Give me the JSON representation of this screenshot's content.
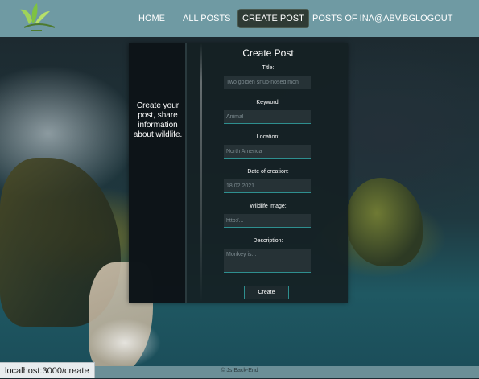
{
  "nav": {
    "home": "HOME",
    "all_posts": "ALL POSTS",
    "create_post": "CREATE POST",
    "my_posts": "POSTS OF INA@ABV.BG",
    "logout": "LOGOUT"
  },
  "form": {
    "side_text": "Create your post, share information about wildlife.",
    "title": "Create Post",
    "fields": [
      {
        "label": "Title:",
        "placeholder": "Two golden snub-nosed mon"
      },
      {
        "label": "Keyword:",
        "placeholder": "Animal"
      },
      {
        "label": "Location:",
        "placeholder": "North America"
      },
      {
        "label": "Date of creation:",
        "placeholder": "18.02.2021"
      },
      {
        "label": "Wildlife image:",
        "placeholder": "http:/..."
      },
      {
        "label": "Description:",
        "placeholder": "Monkey is..."
      }
    ],
    "submit": "Create"
  },
  "footer": {
    "text": "© Js Back-End"
  },
  "status_url": "localhost:3000/create",
  "colors": {
    "header": "#6f9aa3",
    "accent": "#2e8f8f",
    "active_nav": "#2f3b35"
  }
}
